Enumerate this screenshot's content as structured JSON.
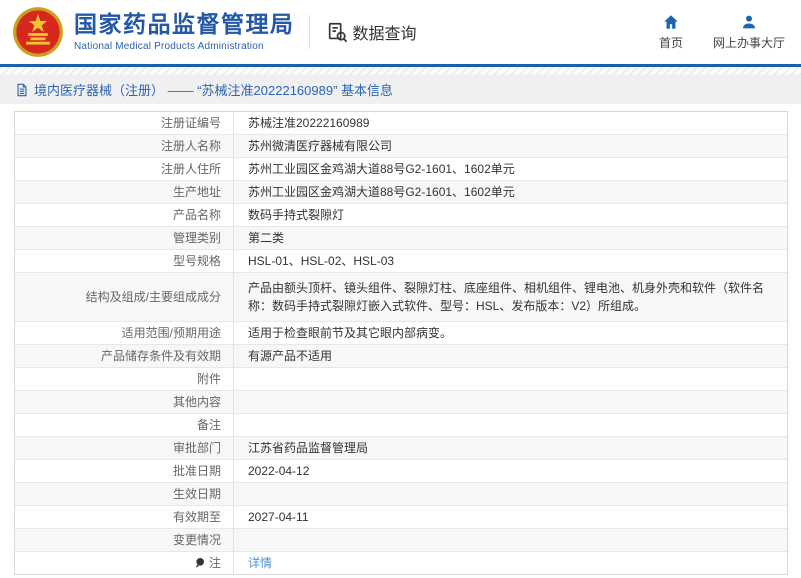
{
  "header": {
    "title": "国家药品监督管理局",
    "subtitle": "National Medical Products Administration",
    "data_query_label": "数据查询",
    "nav": [
      {
        "label": "首页"
      },
      {
        "label": "网上办事大厅"
      }
    ]
  },
  "breadcrumb": {
    "text": "境内医疗器械（注册） —— “苏械注准20222160989” 基本信息"
  },
  "table": {
    "rows": [
      {
        "label": "注册证编号",
        "value": "苏械注准20222160989"
      },
      {
        "label": "注册人名称",
        "value": "苏州微清医疗器械有限公司"
      },
      {
        "label": "注册人住所",
        "value": "苏州工业园区金鸡湖大道88号G2-1601、1602单元"
      },
      {
        "label": "生产地址",
        "value": "苏州工业园区金鸡湖大道88号G2-1601、1602单元"
      },
      {
        "label": "产品名称",
        "value": "数码手持式裂隙灯"
      },
      {
        "label": "管理类别",
        "value": "第二类"
      },
      {
        "label": "型号规格",
        "value": "HSL-01、HSL-02、HSL-03"
      },
      {
        "label": "结构及组成/主要组成成分",
        "value": "产品由额头顶杆、镜头组件、裂隙灯柱、底座组件、相机组件、锂电池、机身外壳和软件（软件名称：数码手持式裂隙灯嵌入式软件、型号：HSL、发布版本：V2）所组成。"
      },
      {
        "label": "适用范围/预期用途",
        "value": "适用于检查眼前节及其它眼内部病变。"
      },
      {
        "label": "产品储存条件及有效期",
        "value": "有源产品不适用"
      },
      {
        "label": "附件",
        "value": ""
      },
      {
        "label": "其他内容",
        "value": ""
      },
      {
        "label": "备注",
        "value": ""
      },
      {
        "label": "审批部门",
        "value": "江苏省药品监督管理局"
      },
      {
        "label": "批准日期",
        "value": "2022-04-12"
      },
      {
        "label": "生效日期",
        "value": ""
      },
      {
        "label": "有效期至",
        "value": "2027-04-11"
      },
      {
        "label": "变更情况",
        "value": ""
      },
      {
        "label": "注",
        "value": "详情"
      }
    ]
  },
  "colors": {
    "brand_blue": "#2358a7",
    "header_border": "#1b5fa8",
    "icon_blue": "#1a66b3",
    "breadcrumb_blue": "#2d64b3",
    "link_blue": "#4d94d6",
    "alt_row_bg": "#f7f7f7",
    "emblem_red": "#d7281f",
    "emblem_gold": "#f2c431"
  }
}
